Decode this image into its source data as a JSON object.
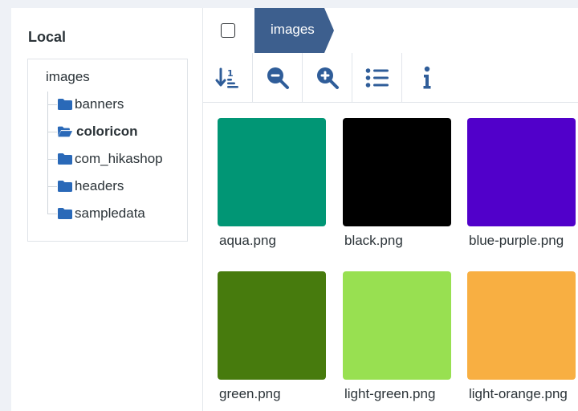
{
  "sidebar": {
    "title": "Local",
    "root": "images",
    "folders": [
      {
        "label": "banners",
        "active": false
      },
      {
        "label": "coloricon",
        "active": true
      },
      {
        "label": "com_hikashop",
        "active": false
      },
      {
        "label": "headers",
        "active": false
      },
      {
        "label": "sampledata",
        "active": false
      }
    ]
  },
  "breadcrumb": {
    "current": "images"
  },
  "toolbar": {
    "icons": [
      "sort-ascending-icon",
      "zoom-out-icon",
      "zoom-in-icon",
      "list-view-icon",
      "info-icon"
    ]
  },
  "files": [
    {
      "name": "aqua.png",
      "color": "#019675"
    },
    {
      "name": "black.png",
      "color": "#000000"
    },
    {
      "name": "blue-purple.png",
      "color": "#5100ca"
    },
    {
      "name": "green.png",
      "color": "#477b0d"
    },
    {
      "name": "light-green.png",
      "color": "#98e051"
    },
    {
      "name": "light-orange.png",
      "color": "#f8af42"
    }
  ],
  "colors": {
    "accent": "#2f5d99",
    "breadcrumb_bg": "#3d5f8e",
    "folder": "#2a69b8"
  }
}
